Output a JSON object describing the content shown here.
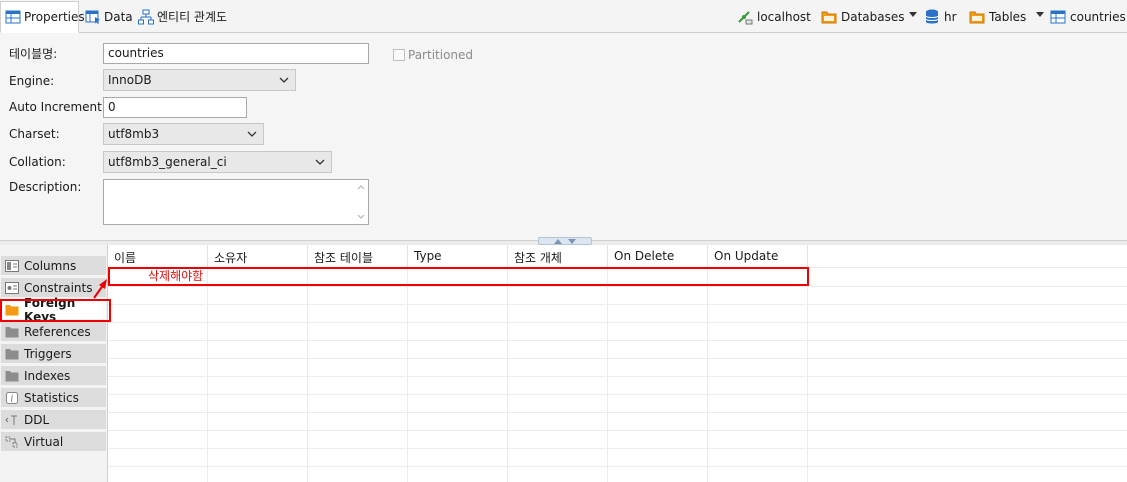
{
  "tabs": [
    {
      "label": "Properties",
      "icon": "table-properties-icon",
      "active": true
    },
    {
      "label": "Data",
      "icon": "data-grid-icon",
      "active": false
    },
    {
      "label": "엔티티 관계도",
      "icon": "er-diagram-icon",
      "active": false
    }
  ],
  "breadcrumb": {
    "connection": "localhost",
    "databases": "Databases",
    "schema": "hr",
    "tables": "Tables",
    "table": "countries"
  },
  "form": {
    "table_name_label": "테이블명:",
    "table_name_value": "countries",
    "partitioned_label": "Partitioned",
    "engine_label": "Engine:",
    "engine_value": "InnoDB",
    "auto_increment_label": "Auto Increment:",
    "auto_increment_value": "0",
    "charset_label": "Charset:",
    "charset_value": "utf8mb3",
    "collation_label": "Collation:",
    "collation_value": "utf8mb3_general_ci",
    "description_label": "Description:",
    "description_value": ""
  },
  "nav": [
    {
      "label": "Columns",
      "icon": "columns-icon"
    },
    {
      "label": "Constraints",
      "icon": "constraints-icon"
    },
    {
      "label": "Foreign Keys",
      "icon": "folder-icon",
      "active": true
    },
    {
      "label": "References",
      "icon": "folder-icon"
    },
    {
      "label": "Triggers",
      "icon": "folder-icon"
    },
    {
      "label": "Indexes",
      "icon": "folder-icon"
    },
    {
      "label": "Statistics",
      "icon": "info-icon"
    },
    {
      "label": "DDL",
      "icon": "ddl-icon"
    },
    {
      "label": "Virtual",
      "icon": "virtual-icon"
    }
  ],
  "grid": {
    "columns": [
      "이름",
      "소유자",
      "참조 테이블",
      "Type",
      "참조 개체",
      "On Delete",
      "On Update"
    ],
    "rows": [
      [
        "삭제해야함",
        "",
        "",
        "",
        "",
        "",
        ""
      ]
    ]
  },
  "colors": {
    "accent": "#2a72c9",
    "folder": "#f59a12",
    "annotation": "#e00000"
  }
}
